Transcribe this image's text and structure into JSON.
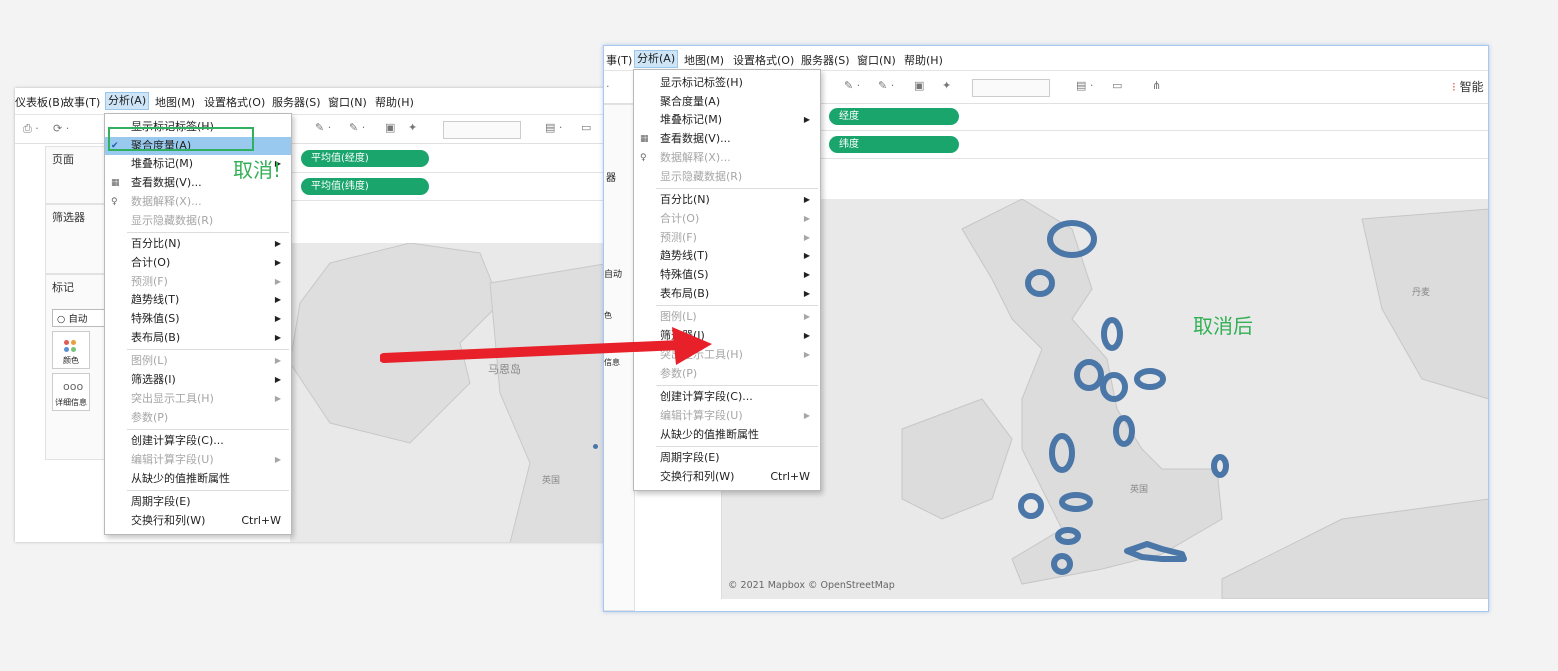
{
  "left_window": {
    "menu": [
      "仪表板(B)",
      "故事(T)",
      "分析(A)",
      "地图(M)",
      "设置格式(O)",
      "服务器(S)",
      "窗口(N)",
      "帮助(H)"
    ],
    "panels": {
      "pages": "页面",
      "filters": "筛选器",
      "marks": "标记"
    },
    "marks_type": "自动",
    "marks_buttons": [
      "颜色",
      "详细信息"
    ],
    "columns_pill": "平均值(经度)",
    "rows_pill": "平均值(纬度)",
    "map_labels": [
      "马恩岛",
      "英国"
    ],
    "dropdown": {
      "items": [
        {
          "label": "显示标记标签(H)",
          "enabled": true
        },
        {
          "label": "聚合度量(A)",
          "enabled": true,
          "checked": true
        },
        {
          "label": "堆叠标记(M)",
          "enabled": true
        },
        {
          "label": "查看数据(V)...",
          "enabled": true
        },
        {
          "label": "数据解释(X)...",
          "enabled": false
        },
        {
          "label": "显示隐藏数据(R)",
          "enabled": false
        },
        {
          "label": "百分比(N)",
          "enabled": true
        },
        {
          "label": "合计(O)",
          "enabled": true
        },
        {
          "label": "预测(F)",
          "enabled": false
        },
        {
          "label": "趋势线(T)",
          "enabled": true
        },
        {
          "label": "特殊值(S)",
          "enabled": true
        },
        {
          "label": "表布局(B)",
          "enabled": true
        },
        {
          "label": "图例(L)",
          "enabled": false
        },
        {
          "label": "筛选器(I)",
          "enabled": true
        },
        {
          "label": "突出显示工具(H)",
          "enabled": false
        },
        {
          "label": "参数(P)",
          "enabled": false
        },
        {
          "label": "创建计算字段(C)...",
          "enabled": true
        },
        {
          "label": "编辑计算字段(U)",
          "enabled": false
        },
        {
          "label": "从缺少的值推断属性",
          "enabled": true
        },
        {
          "label": "周期字段(E)",
          "enabled": true
        },
        {
          "label": "交换行和列(W)",
          "enabled": true,
          "shortcut": "Ctrl+W"
        }
      ]
    }
  },
  "annotation_cancel": "取消!",
  "annotation_after": "取消后",
  "right_window": {
    "menu": [
      "事(T)",
      "分析(A)",
      "地图(M)",
      "设置格式(O)",
      "服务器(S)",
      "窗口(N)",
      "帮助(H)"
    ],
    "columns_pill": "经度",
    "rows_pill": "纬度",
    "side_labels": [
      "器",
      "自动",
      "色",
      "信息"
    ],
    "smart_label": "智能",
    "map_labels": [
      "英国",
      "丹麦"
    ],
    "attribution": "© 2021 Mapbox © OpenStreetMap",
    "dropdown": {
      "items": [
        {
          "label": "显示标记标签(H)",
          "enabled": true
        },
        {
          "label": "聚合度量(A)",
          "enabled": true
        },
        {
          "label": "堆叠标记(M)",
          "enabled": true
        },
        {
          "label": "查看数据(V)...",
          "enabled": true
        },
        {
          "label": "数据解释(X)...",
          "enabled": false
        },
        {
          "label": "显示隐藏数据(R)",
          "enabled": false
        },
        {
          "label": "百分比(N)",
          "enabled": true
        },
        {
          "label": "合计(O)",
          "enabled": false
        },
        {
          "label": "预测(F)",
          "enabled": false
        },
        {
          "label": "趋势线(T)",
          "enabled": true
        },
        {
          "label": "特殊值(S)",
          "enabled": true
        },
        {
          "label": "表布局(B)",
          "enabled": true
        },
        {
          "label": "图例(L)",
          "enabled": false
        },
        {
          "label": "筛选器(I)",
          "enabled": true
        },
        {
          "label": "突出显示工具(H)",
          "enabled": false
        },
        {
          "label": "参数(P)",
          "enabled": false
        },
        {
          "label": "创建计算字段(C)...",
          "enabled": true
        },
        {
          "label": "编辑计算字段(U)",
          "enabled": false
        },
        {
          "label": "从缺少的值推断属性",
          "enabled": true
        },
        {
          "label": "周期字段(E)",
          "enabled": true
        },
        {
          "label": "交换行和列(W)",
          "enabled": true,
          "shortcut": "Ctrl+W"
        }
      ]
    }
  },
  "colors": {
    "pill_green": "#1aa56d",
    "highlight_blue": "#99c9ef",
    "mark_blue": "#4a76a8",
    "arrow_red": "#e8202a",
    "annot_green": "#33b055"
  },
  "icons": [
    "check-icon",
    "table-icon",
    "lightbulb-icon",
    "submenu-arrow-icon",
    "red-arrow"
  ]
}
